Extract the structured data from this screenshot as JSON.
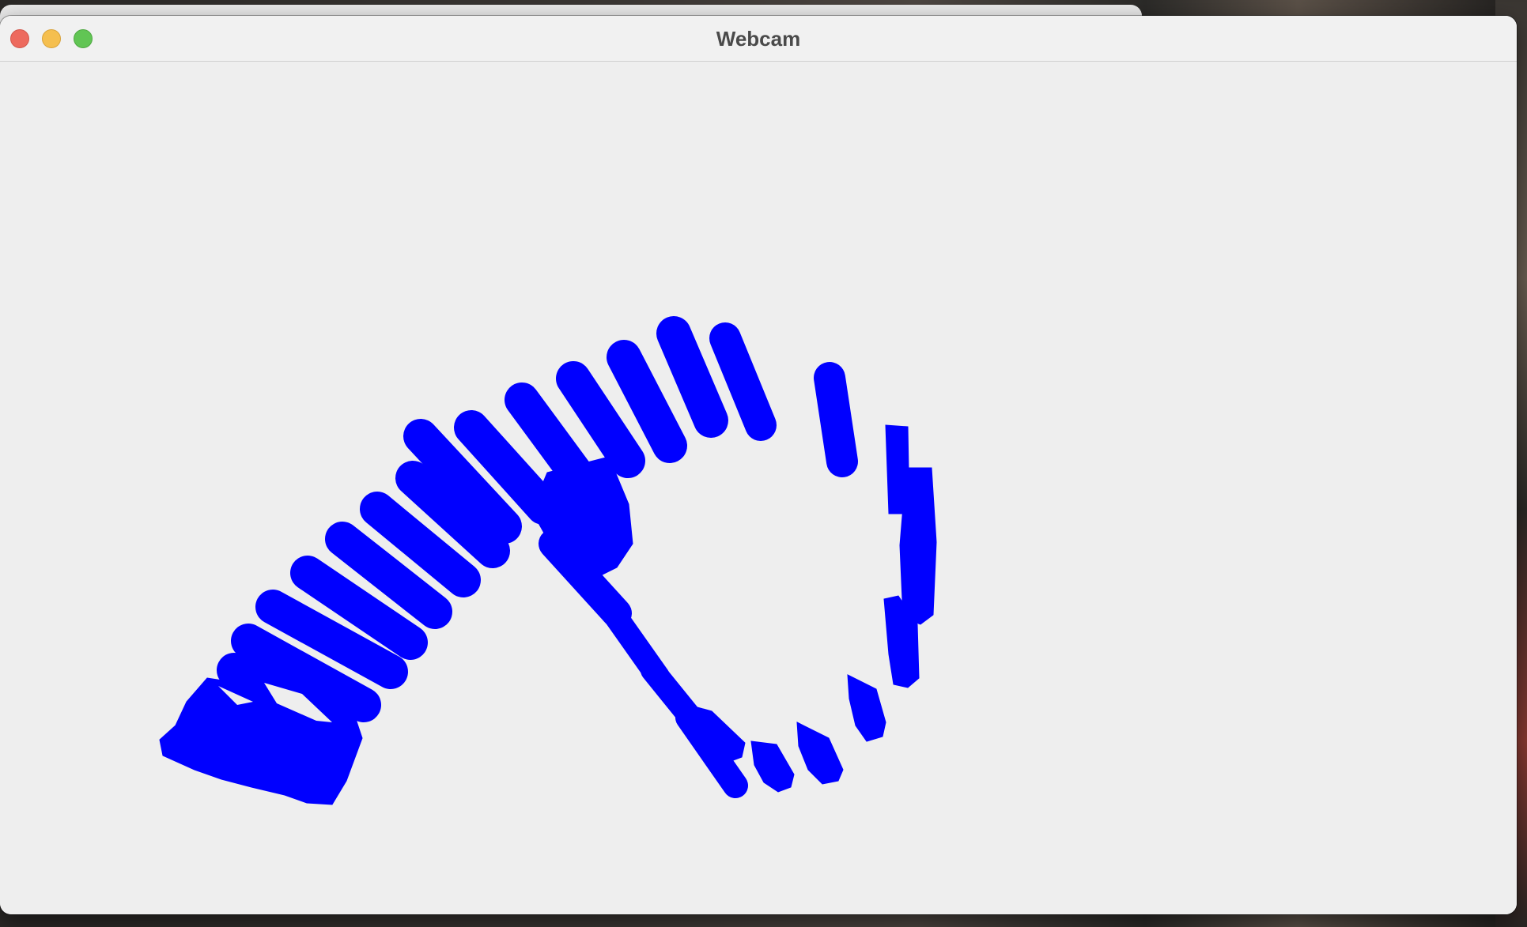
{
  "window": {
    "title": "Webcam",
    "controls": [
      "close",
      "minimize",
      "zoom"
    ]
  },
  "frame": {
    "description_colors": {
      "background": "#eeeeee",
      "mask": "#0000ff"
    }
  }
}
